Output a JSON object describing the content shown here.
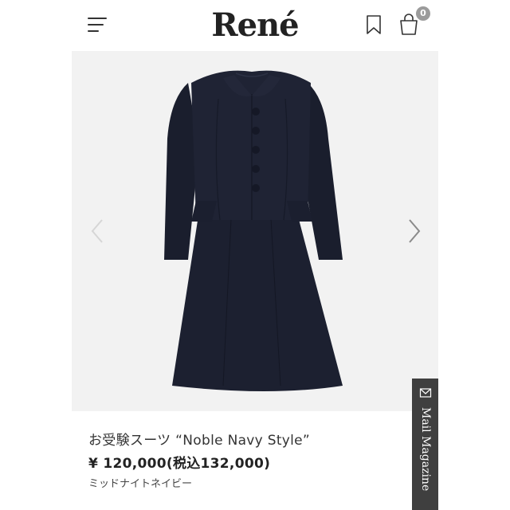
{
  "header": {
    "brand": "René",
    "cart_count": "0",
    "icons": {
      "menu": "hamburger-icon",
      "bookmark": "bookmark-icon",
      "cart": "shopping-bag-icon"
    }
  },
  "gallery": {
    "image": "navy-suit-jacket-and-dress",
    "prev_icon": "chevron-left-icon",
    "next_icon": "chevron-right-icon"
  },
  "product": {
    "name": "お受験スーツ “Noble Navy Style”",
    "price": "¥ 120,000(税込132,000)",
    "color": "ミッドナイトネイビー"
  },
  "mail_tab": {
    "label": "Mail Magazine",
    "icon": "envelope-icon"
  },
  "colors": {
    "garment": "#1c2030",
    "gallery_bg": "#f2f2f2",
    "badge": "#9b9b9b",
    "mail_tab_bg": "#3f3f3f"
  }
}
